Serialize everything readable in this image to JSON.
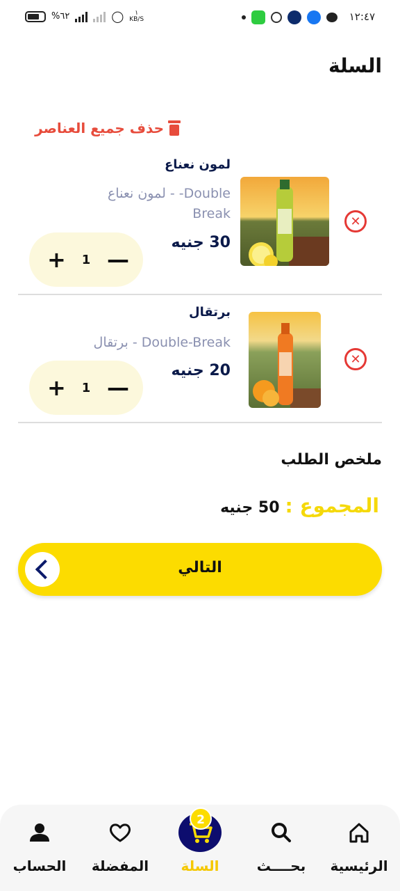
{
  "status_bar": {
    "time": "١٢:٤٧",
    "battery": "%٦٢",
    "net_speed_value": "١",
    "net_speed_unit": "KB/S"
  },
  "header": {
    "title": "السلة"
  },
  "clear_all_label": "حذف جميع العناصر",
  "items": [
    {
      "name": "لمون نعناع",
      "description": "لمون نعناع - -Double Break",
      "price": "30 جنيه",
      "quantity": "1"
    },
    {
      "name": "برتقال",
      "description": "برتقال - Double-Break",
      "price": "20 جنيه",
      "quantity": "1"
    }
  ],
  "summary": {
    "title": "ملخص الطلب",
    "total_label": "المجموع :",
    "total_value": "50 جنيه"
  },
  "next_button": {
    "label": "التالي"
  },
  "bottom_nav": {
    "home": "الرئيسية",
    "search": "بحــــث",
    "cart": "السلة",
    "cart_badge": "2",
    "favorites": "المفضلة",
    "account": "الحساب"
  },
  "colors": {
    "accent_yellow": "#fcdc00",
    "danger_red": "#e53935",
    "navy": "#0b1a4a"
  }
}
